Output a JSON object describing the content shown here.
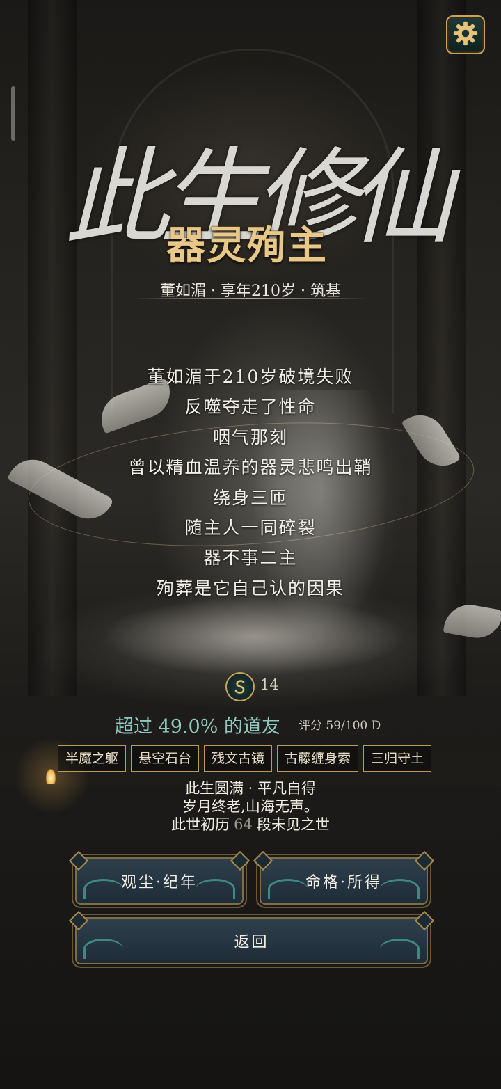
{
  "game": {
    "title_calligraphy": "此生修仙",
    "ending_title": "器灵殉主",
    "character_info": "董如湄 · 享年210岁 · 筑基"
  },
  "story": [
    "董如湄于210岁破境失败",
    "反噬夺走了性命",
    "咽气那刻",
    "曾以精血温养的器灵悲鸣出鞘",
    "绕身三匝",
    "随主人一同碎裂",
    "器不事二主",
    "殉葬是它自己认的因果"
  ],
  "score": {
    "icon": "coin-s-icon",
    "value": "14",
    "beat_text": "超过 49.0% 的道友",
    "rating_text": "评分 59/100  D"
  },
  "tags": [
    "半魔之躯",
    "悬空石台",
    "残文古镜",
    "古藤缠身索",
    "三归守土"
  ],
  "summary": {
    "line1": "此生圆满 · 平凡自得",
    "line2": "岁月终老,山海无声。",
    "line3_prefix": "此世初历",
    "line3_count": "64",
    "line3_suffix": "段未见之世"
  },
  "buttons": {
    "chronicle": "观尘·纪年",
    "fate": "命格·所得",
    "back": "返回"
  },
  "colors": {
    "gold": "#e8c889",
    "teal_text": "#8fc9bf",
    "button_bg": "#2e3f4c"
  }
}
